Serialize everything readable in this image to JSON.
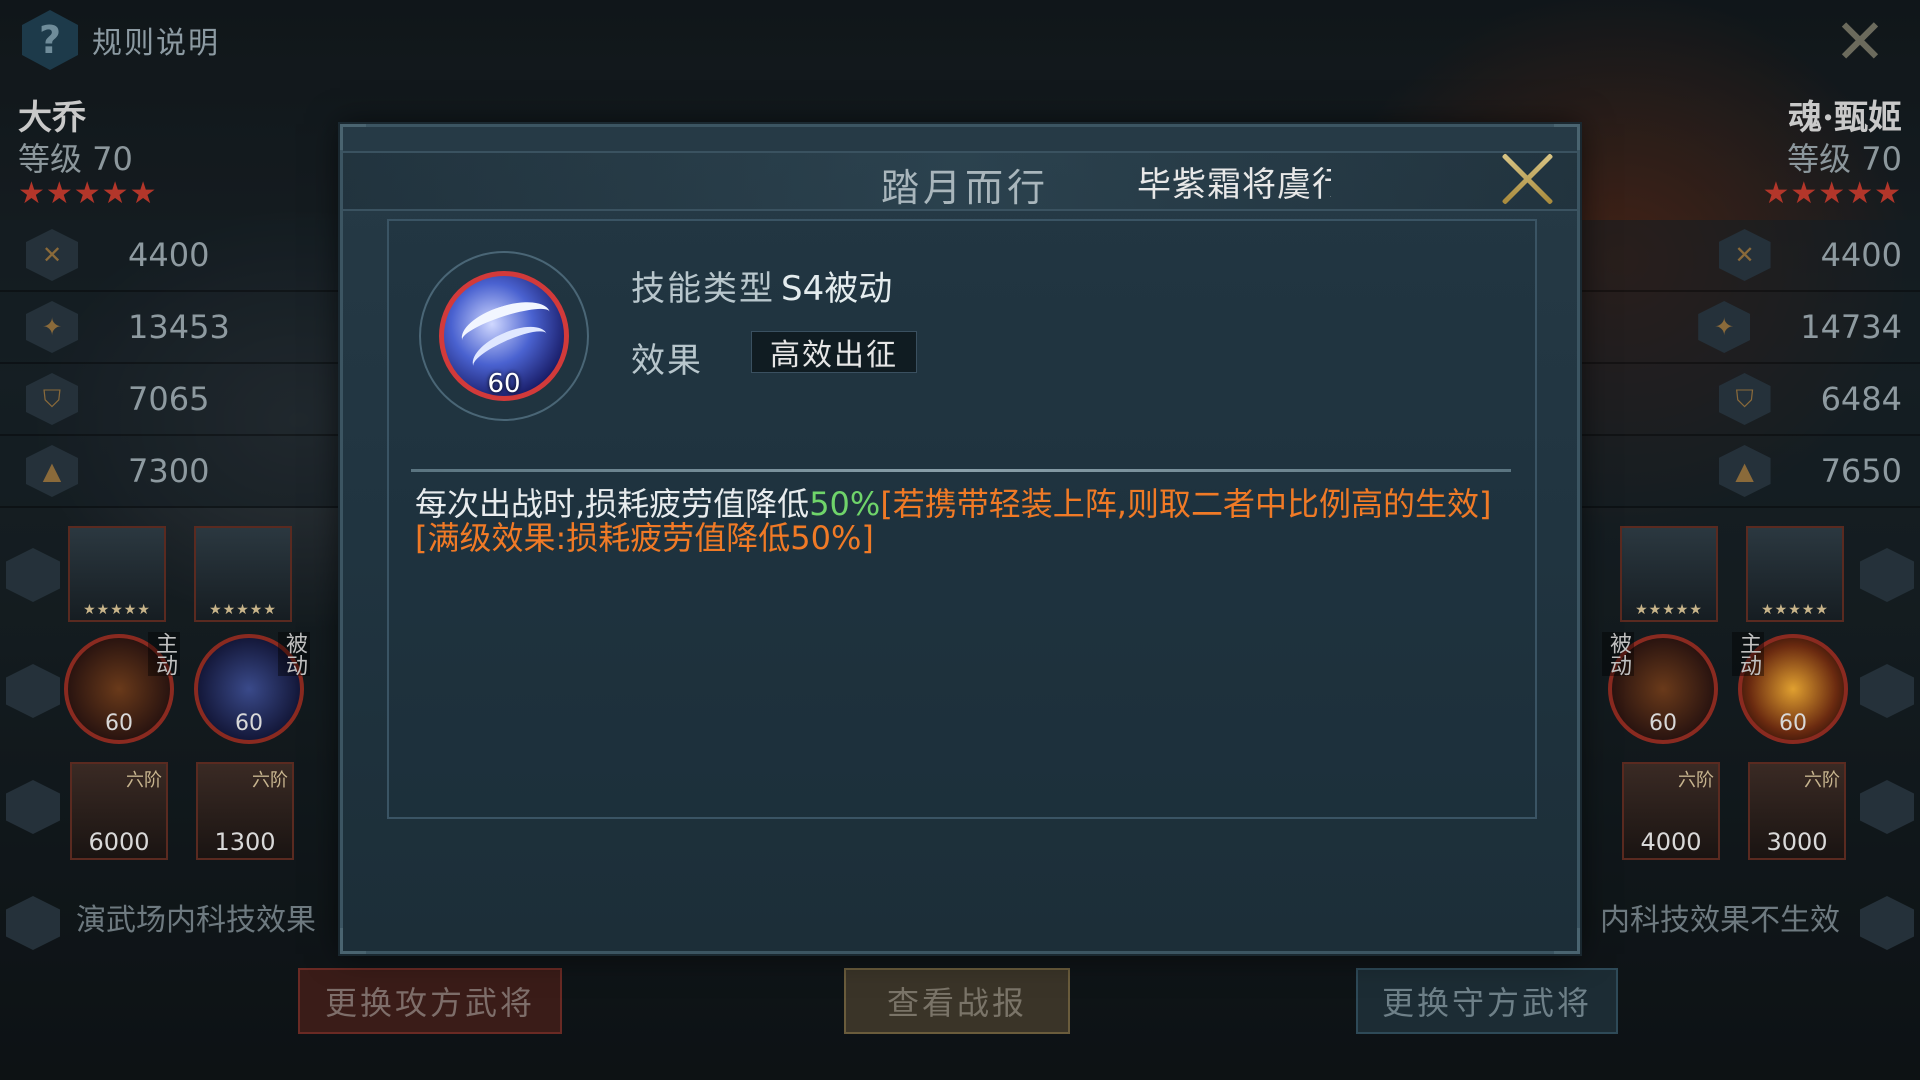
{
  "topbar": {
    "rules_label": "规则说明",
    "help_icon": "question-icon",
    "close_icon": "close-icon"
  },
  "attacker": {
    "name": "大乔",
    "level": "等级  70",
    "stars": "★★★★★",
    "stats": [
      "4400",
      "13453",
      "7065",
      "7300"
    ],
    "skills": [
      {
        "tag": "主动",
        "level": "60"
      },
      {
        "tag": "被动",
        "level": "60"
      }
    ],
    "troops": [
      {
        "rank": "六阶",
        "count": "6000"
      },
      {
        "rank": "六阶",
        "count": "1300"
      }
    ],
    "equip_stars": "★★★★★",
    "tech_note": "演武场内科技效果"
  },
  "defender": {
    "name": "魂·甄姬",
    "level": "等级  70",
    "stars": "★★★★★",
    "stats": [
      "4400",
      "14734",
      "6484",
      "7650"
    ],
    "skills": [
      {
        "tag": "被动",
        "level": "60"
      },
      {
        "tag": "主动",
        "level": "60"
      }
    ],
    "troops": [
      {
        "rank": "六阶",
        "count": "4000"
      },
      {
        "rank": "六阶",
        "count": "3000"
      }
    ],
    "equip_stars": "★★★★★",
    "tech_note": "内科技效果不生效"
  },
  "buttons": {
    "change_attacker": "更换攻方武将",
    "view_report": "查看战报",
    "change_defender": "更换守方武将"
  },
  "modal": {
    "skill_name": "踏月而行",
    "general_name": "毕紫霜将虞行",
    "skill_level": "60",
    "type_label": "技能类型",
    "type_value": "S4被动",
    "effect_label": "效果",
    "effect_value": "高效出征",
    "desc_prefix": "每次出战时,损耗疲劳值降低",
    "desc_pct": "50%",
    "desc_orange": "[若携带轻装上阵,则取二者中比例高的生效][满级效果:损耗疲劳值降低50%]"
  },
  "colors": {
    "accent_gold": "#d8c484",
    "highlight_green": "#6fd46a",
    "highlight_orange": "#f07a26",
    "skill_border": "#d23a3a"
  }
}
